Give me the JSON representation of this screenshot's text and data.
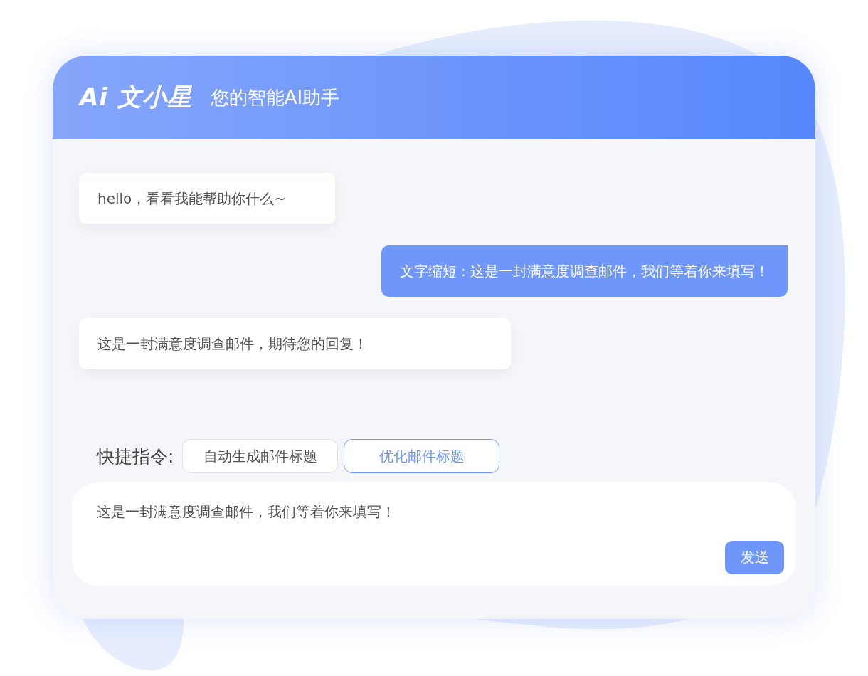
{
  "header": {
    "logo": "Ai 文小星",
    "subtitle": "您的智能AI助手"
  },
  "messages": [
    {
      "kind": "bot",
      "text": "hello，看看我能帮助你什么~"
    },
    {
      "kind": "user",
      "text": "文字缩短 : 这是一封满意度调查邮件，我们等着你来填写！"
    },
    {
      "kind": "bot",
      "text": "这是一封满意度调查邮件，期待您的回复！"
    }
  ],
  "quick_commands": {
    "label": "快捷指令:",
    "items": [
      {
        "label": "自动生成邮件标题",
        "selected": false
      },
      {
        "label": "优化邮件标题",
        "selected": true
      }
    ]
  },
  "input": {
    "value": "这是一封满意度调查邮件，我们等着你来填写！",
    "send_button": "发送"
  }
}
